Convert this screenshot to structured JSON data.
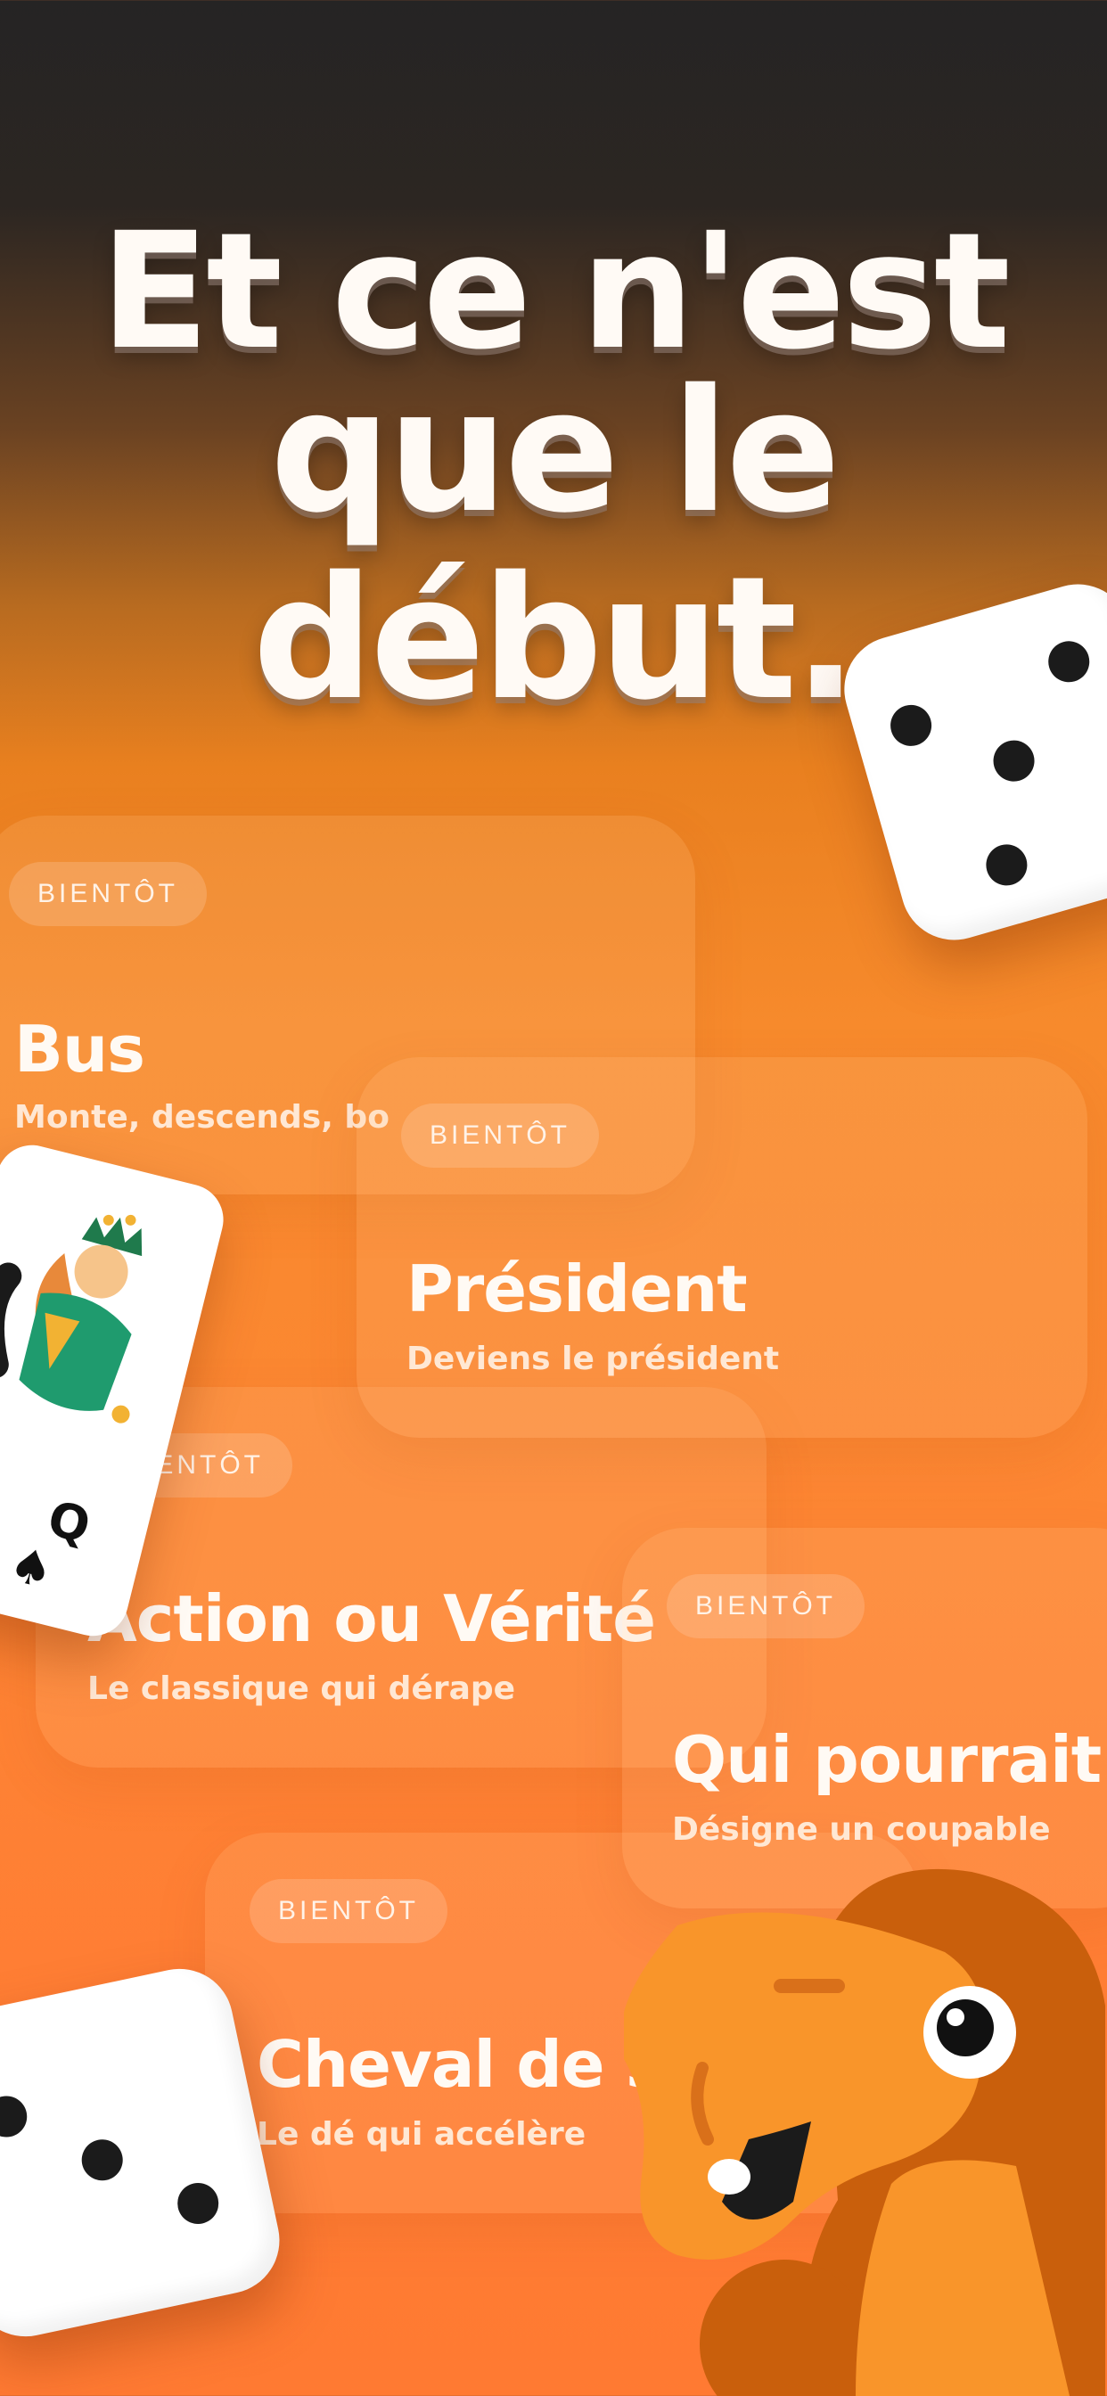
{
  "headline": {
    "line1": "Et ce n'est",
    "line2": "que le début."
  },
  "cards": [
    {
      "badge": "BIENTÔT",
      "title": "Bus",
      "subtitle": "Monte, descends, bo"
    },
    {
      "badge": "BIENTÔT",
      "title": "Président",
      "subtitle": "Deviens le président"
    },
    {
      "badge": "IENTÔT",
      "title": "Action ou Vérité",
      "subtitle": "Le classique qui dérape"
    },
    {
      "badge": "BIENTÔT",
      "title": "Qui pourrait...",
      "subtitle": "Désigne un coupable"
    },
    {
      "badge": "BIENTÔT",
      "title": "Cheval de 3",
      "subtitle": "Le dé qui accélère"
    }
  ],
  "decorations": {
    "die_top_icon": "dice-three-icon",
    "die_bottom_icon": "dice-three-icon",
    "playing_card_icon": "queen-of-spades-card",
    "camel_icon": "camel-mascot",
    "card_rank": "Q",
    "card_suit": "♠"
  },
  "colors": {
    "top_background": "#252424",
    "accent_orange": "#fd8633",
    "camel_body": "#f9952a",
    "camel_mane": "#c95f0c"
  }
}
